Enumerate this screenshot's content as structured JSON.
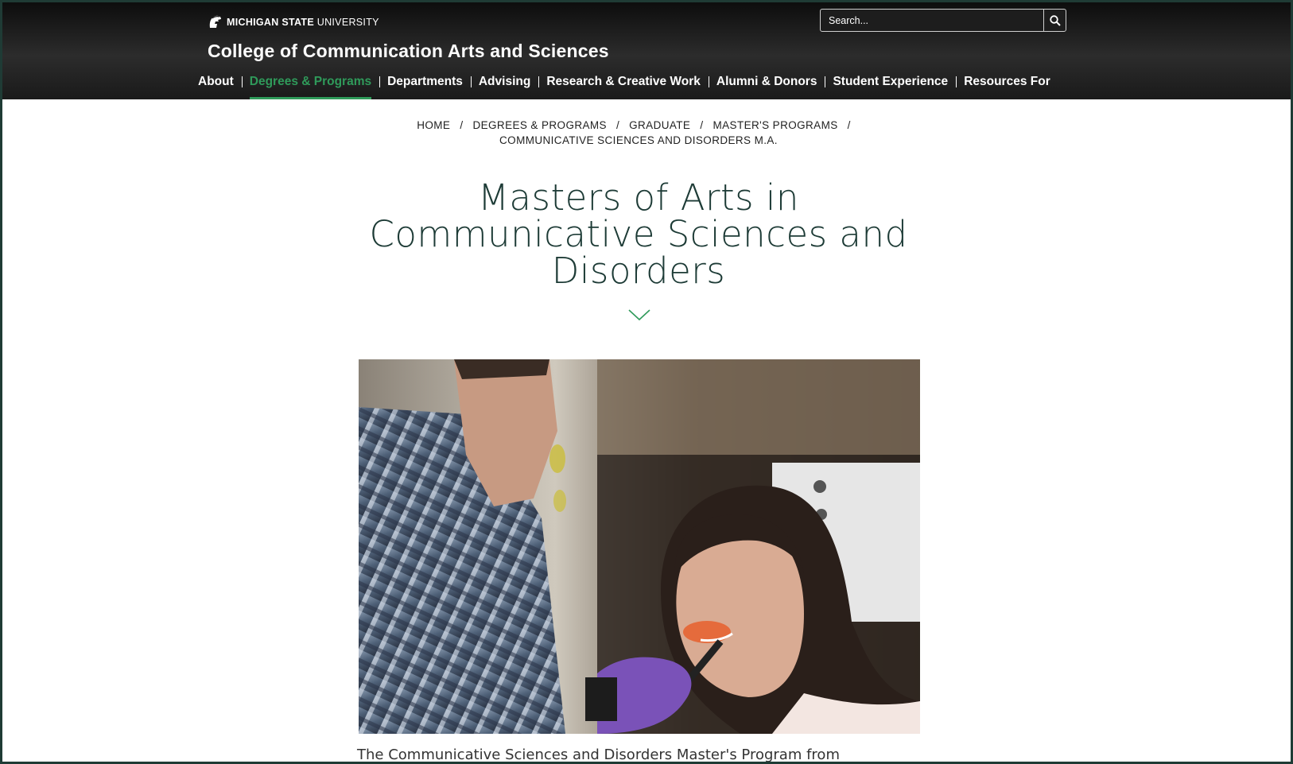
{
  "header": {
    "university_bold": "MICHIGAN STATE",
    "university_rest": " UNIVERSITY",
    "college_title": "College of Communication Arts and Sciences",
    "search_placeholder": "Search..."
  },
  "nav": {
    "items": [
      {
        "label": "About"
      },
      {
        "label": "Degrees & Programs",
        "active": true
      },
      {
        "label": "Departments"
      },
      {
        "label": "Advising"
      },
      {
        "label": "Research & Creative Work"
      },
      {
        "label": "Alumni & Donors"
      },
      {
        "label": "Student Experience"
      },
      {
        "label": "Resources For"
      }
    ]
  },
  "breadcrumb": {
    "items": [
      "HOME",
      "DEGREES & PROGRAMS",
      "GRADUATE",
      "MASTER'S PROGRAMS",
      "COMMUNICATIVE SCIENCES AND DISORDERS M.A."
    ],
    "separator": "/"
  },
  "main": {
    "title_line1": "Masters of Arts in",
    "title_line2": "Communicative Sciences and",
    "title_line3": "Disorders",
    "intro_text": "The Communicative Sciences and Disorders Master's Program from"
  },
  "colors": {
    "accent_green": "#2f9a5a",
    "title_color": "#1d3b36",
    "header_bg": "#1a1a1a"
  },
  "icons": {
    "logo": "spartan-helmet-icon",
    "search": "search-icon",
    "scroll": "chevron-down-icon"
  }
}
